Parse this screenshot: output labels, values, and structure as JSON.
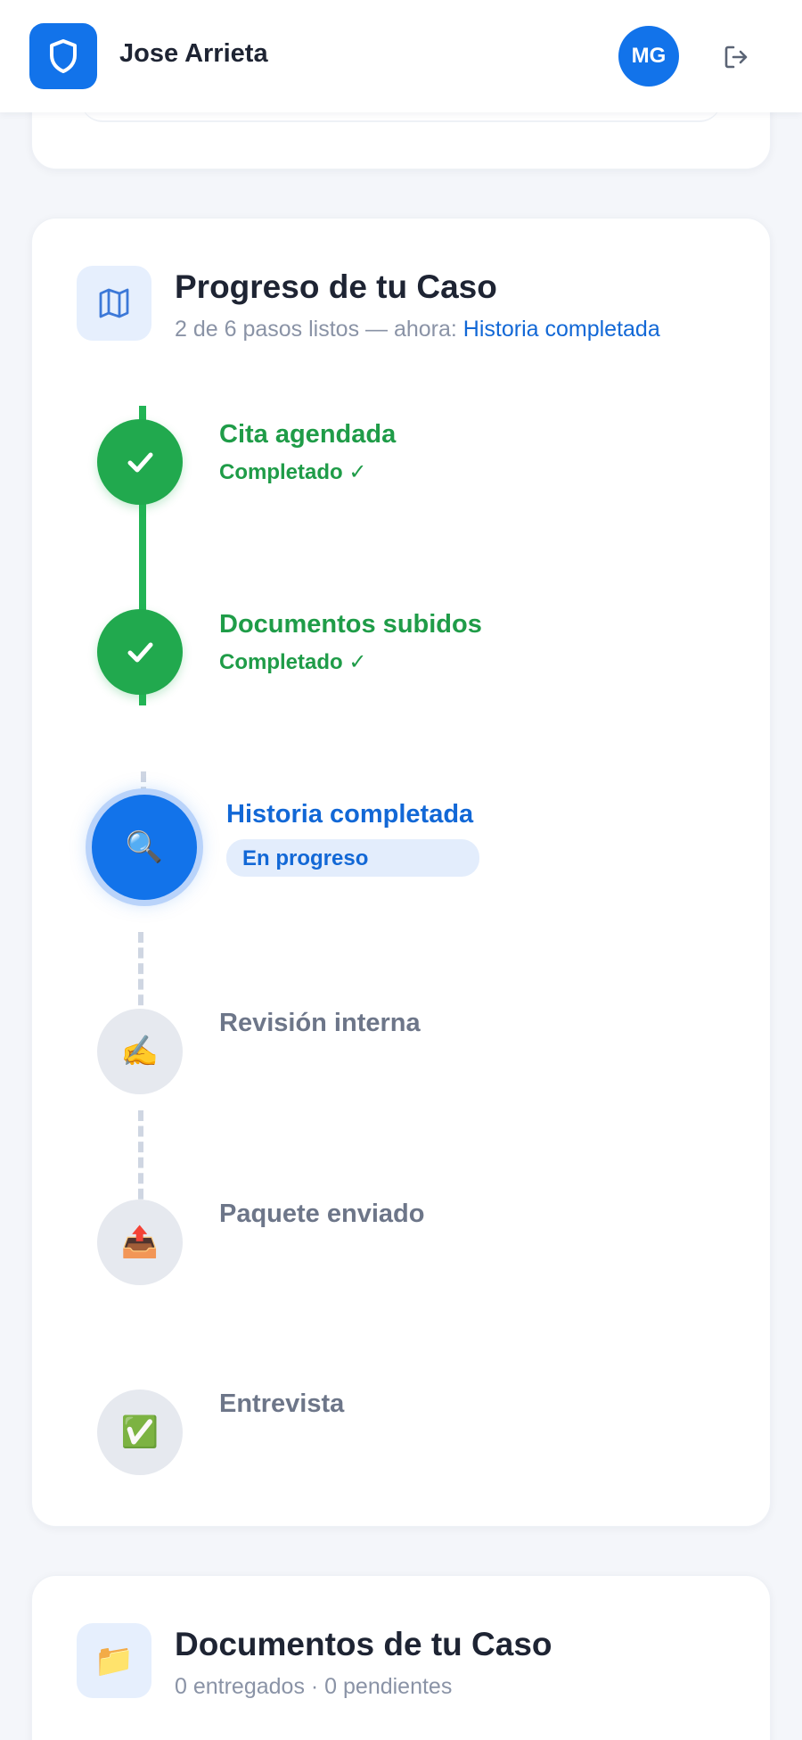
{
  "header": {
    "user_name": "Jose Arrieta",
    "avatar_initials": "MG",
    "logo_icon": "shield-icon",
    "logout_icon": "logout-icon"
  },
  "progress_card": {
    "icon": "map-icon",
    "title": "Progreso de tu Caso",
    "subtitle_prefix": "2 de 6 pasos listos — ahora: ",
    "subtitle_current": "Historia completada",
    "steps": [
      {
        "label": "Cita agendada",
        "status": "Completado ✓",
        "state": "done",
        "icon": "check-icon"
      },
      {
        "label": "Documentos subidos",
        "status": "Completado ✓",
        "state": "done",
        "icon": "check-icon"
      },
      {
        "label": "Historia completada",
        "status": "En progreso",
        "state": "active",
        "icon": "magnifier-icon",
        "emoji": "🔍"
      },
      {
        "label": "Revisión interna",
        "status": "",
        "state": "pending",
        "icon": "writing-hand-icon",
        "emoji": "✍️"
      },
      {
        "label": "Paquete enviado",
        "status": "",
        "state": "pending",
        "icon": "outbox-tray-icon",
        "emoji": "📤"
      },
      {
        "label": "Entrevista",
        "status": "",
        "state": "pending",
        "icon": "check-box-icon",
        "emoji": "✅"
      }
    ]
  },
  "documents_card": {
    "icon": "folder-icon",
    "emoji": "📁",
    "title": "Documentos de tu Caso",
    "subtitle": "0 entregados · 0 pendientes"
  },
  "colors": {
    "primary": "#1273ea",
    "success": "#21a94e",
    "pending": "#e6e9ef",
    "background": "#f4f6fa"
  }
}
